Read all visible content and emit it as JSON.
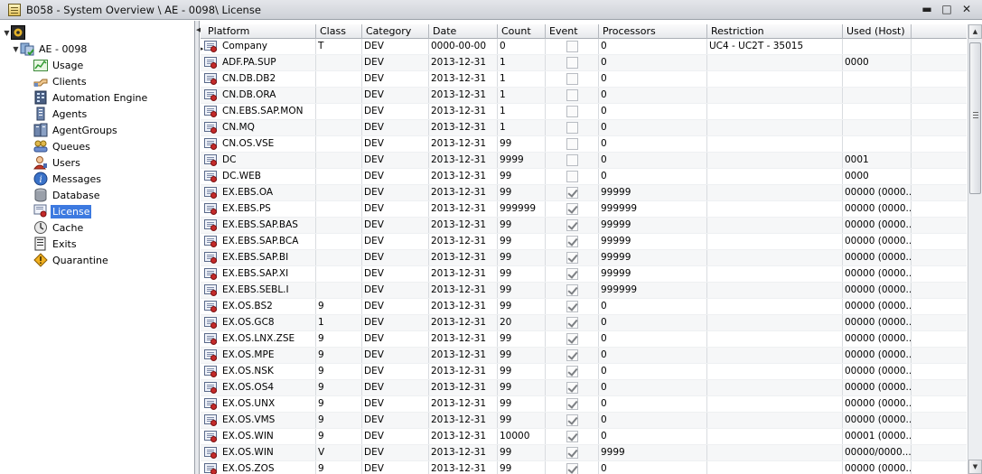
{
  "window": {
    "title": "B058 - System Overview \\ AE - 0098\\ License",
    "minimize": "▬",
    "maximize": "□",
    "close": "✕"
  },
  "tree": {
    "system": "AE - 0098",
    "items": [
      {
        "label": "Usage",
        "icon": "usage-icon"
      },
      {
        "label": "Clients",
        "icon": "clients-icon"
      },
      {
        "label": "Automation Engine",
        "icon": "automation-engine-icon"
      },
      {
        "label": "Agents",
        "icon": "agents-icon"
      },
      {
        "label": "AgentGroups",
        "icon": "agentgroups-icon"
      },
      {
        "label": "Queues",
        "icon": "queues-icon"
      },
      {
        "label": "Users",
        "icon": "users-icon"
      },
      {
        "label": "Messages",
        "icon": "messages-icon"
      },
      {
        "label": "Database",
        "icon": "database-icon"
      },
      {
        "label": "License",
        "icon": "license-icon",
        "selected": true
      },
      {
        "label": "Cache",
        "icon": "cache-icon"
      },
      {
        "label": "Exits",
        "icon": "exits-icon"
      },
      {
        "label": "Quarantine",
        "icon": "quarantine-icon"
      }
    ]
  },
  "table": {
    "columns": [
      "Platform",
      "Class",
      "Category",
      "Date",
      "Count",
      "Event",
      "Processors",
      "Restriction",
      "Used (Host)"
    ],
    "rows": [
      {
        "platform": "Company",
        "class": "T",
        "category": "DEV",
        "date": "0000-00-00",
        "count": "0",
        "event": false,
        "processors": "0",
        "restriction": "UC4 - UC2T - 35015",
        "used": ""
      },
      {
        "platform": "ADF.PA.SUP",
        "class": "",
        "category": "DEV",
        "date": "2013-12-31",
        "count": "1",
        "event": false,
        "processors": "0",
        "restriction": "",
        "used": "0000"
      },
      {
        "platform": "CN.DB.DB2",
        "class": "",
        "category": "DEV",
        "date": "2013-12-31",
        "count": "1",
        "event": false,
        "processors": "0",
        "restriction": "",
        "used": ""
      },
      {
        "platform": "CN.DB.ORA",
        "class": "",
        "category": "DEV",
        "date": "2013-12-31",
        "count": "1",
        "event": false,
        "processors": "0",
        "restriction": "",
        "used": ""
      },
      {
        "platform": "CN.EBS.SAP.MON",
        "class": "",
        "category": "DEV",
        "date": "2013-12-31",
        "count": "1",
        "event": false,
        "processors": "0",
        "restriction": "",
        "used": ""
      },
      {
        "platform": "CN.MQ",
        "class": "",
        "category": "DEV",
        "date": "2013-12-31",
        "count": "1",
        "event": false,
        "processors": "0",
        "restriction": "",
        "used": ""
      },
      {
        "platform": "CN.OS.VSE",
        "class": "",
        "category": "DEV",
        "date": "2013-12-31",
        "count": "99",
        "event": false,
        "processors": "0",
        "restriction": "",
        "used": ""
      },
      {
        "platform": "DC",
        "class": "",
        "category": "DEV",
        "date": "2013-12-31",
        "count": "9999",
        "event": false,
        "processors": "0",
        "restriction": "",
        "used": "0001"
      },
      {
        "platform": "DC.WEB",
        "class": "",
        "category": "DEV",
        "date": "2013-12-31",
        "count": "99",
        "event": false,
        "processors": "0",
        "restriction": "",
        "used": "0000"
      },
      {
        "platform": "EX.EBS.OA",
        "class": "",
        "category": "DEV",
        "date": "2013-12-31",
        "count": "99",
        "event": true,
        "processors": "99999",
        "restriction": "",
        "used": "00000 (0000..."
      },
      {
        "platform": "EX.EBS.PS",
        "class": "",
        "category": "DEV",
        "date": "2013-12-31",
        "count": "999999",
        "event": true,
        "processors": "999999",
        "restriction": "",
        "used": "00000 (0000..."
      },
      {
        "platform": "EX.EBS.SAP.BAS",
        "class": "",
        "category": "DEV",
        "date": "2013-12-31",
        "count": "99",
        "event": true,
        "processors": "99999",
        "restriction": "",
        "used": "00000 (0000..."
      },
      {
        "platform": "EX.EBS.SAP.BCA",
        "class": "",
        "category": "DEV",
        "date": "2013-12-31",
        "count": "99",
        "event": true,
        "processors": "99999",
        "restriction": "",
        "used": "00000 (0000..."
      },
      {
        "platform": "EX.EBS.SAP.BI",
        "class": "",
        "category": "DEV",
        "date": "2013-12-31",
        "count": "99",
        "event": true,
        "processors": "99999",
        "restriction": "",
        "used": "00000 (0000..."
      },
      {
        "platform": "EX.EBS.SAP.XI",
        "class": "",
        "category": "DEV",
        "date": "2013-12-31",
        "count": "99",
        "event": true,
        "processors": "99999",
        "restriction": "",
        "used": "00000 (0000..."
      },
      {
        "platform": "EX.EBS.SEBL.I",
        "class": "",
        "category": "DEV",
        "date": "2013-12-31",
        "count": "99",
        "event": true,
        "processors": "999999",
        "restriction": "",
        "used": "00000 (0000..."
      },
      {
        "platform": "EX.OS.BS2",
        "class": "9",
        "category": "DEV",
        "date": "2013-12-31",
        "count": "99",
        "event": true,
        "processors": "0",
        "restriction": "",
        "used": "00000 (0000..."
      },
      {
        "platform": "EX.OS.GC8",
        "class": "1",
        "category": "DEV",
        "date": "2013-12-31",
        "count": "20",
        "event": true,
        "processors": "0",
        "restriction": "",
        "used": "00000 (0000..."
      },
      {
        "platform": "EX.OS.LNX.ZSE",
        "class": "9",
        "category": "DEV",
        "date": "2013-12-31",
        "count": "99",
        "event": true,
        "processors": "0",
        "restriction": "",
        "used": "00000 (0000..."
      },
      {
        "platform": "EX.OS.MPE",
        "class": "9",
        "category": "DEV",
        "date": "2013-12-31",
        "count": "99",
        "event": true,
        "processors": "0",
        "restriction": "",
        "used": "00000 (0000..."
      },
      {
        "platform": "EX.OS.NSK",
        "class": "9",
        "category": "DEV",
        "date": "2013-12-31",
        "count": "99",
        "event": true,
        "processors": "0",
        "restriction": "",
        "used": "00000 (0000..."
      },
      {
        "platform": "EX.OS.OS4",
        "class": "9",
        "category": "DEV",
        "date": "2013-12-31",
        "count": "99",
        "event": true,
        "processors": "0",
        "restriction": "",
        "used": "00000 (0000..."
      },
      {
        "platform": "EX.OS.UNX",
        "class": "9",
        "category": "DEV",
        "date": "2013-12-31",
        "count": "99",
        "event": true,
        "processors": "0",
        "restriction": "",
        "used": "00000 (0000..."
      },
      {
        "platform": "EX.OS.VMS",
        "class": "9",
        "category": "DEV",
        "date": "2013-12-31",
        "count": "99",
        "event": true,
        "processors": "0",
        "restriction": "",
        "used": "00000 (0000..."
      },
      {
        "platform": "EX.OS.WIN",
        "class": "9",
        "category": "DEV",
        "date": "2013-12-31",
        "count": "10000",
        "event": true,
        "processors": "0",
        "restriction": "",
        "used": "00001 (0000..."
      },
      {
        "platform": "EX.OS.WIN",
        "class": "V",
        "category": "DEV",
        "date": "2013-12-31",
        "count": "99",
        "event": true,
        "processors": "9999",
        "restriction": "",
        "used": "00000/0000..."
      },
      {
        "platform": "EX.OS.ZOS",
        "class": "9",
        "category": "DEV",
        "date": "2013-12-31",
        "count": "99",
        "event": true,
        "processors": "0",
        "restriction": "",
        "used": "00000 (0000..."
      }
    ]
  }
}
